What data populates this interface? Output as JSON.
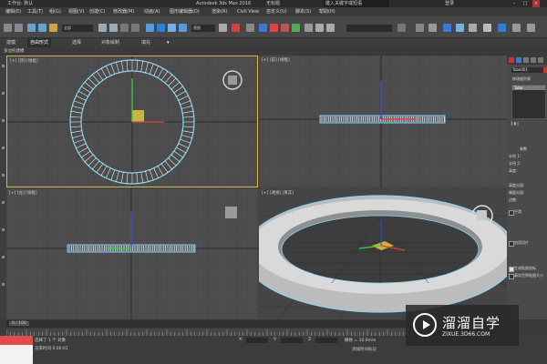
{
  "title_bar": {
    "left_label": "工作台: 默认",
    "app_title": "Autodesk 3ds Max 2016",
    "doc_title": "无标题",
    "search_placeholder": "键入关键字或短语",
    "login_label": "登录"
  },
  "menu": [
    "编辑(E)",
    "工具(T)",
    "组(G)",
    "视图(V)",
    "创建(C)",
    "修改器(M)",
    "动画(A)",
    "图形编辑器(D)",
    "渲染(R)",
    "Civil View",
    "自定义(U)",
    "脚本(S)",
    "帮助(H)"
  ],
  "toolbar": {
    "selection_filter": "全部",
    "view_dropdown": "视图"
  },
  "ribbon": {
    "tabs": [
      "建模",
      "自由形式",
      "选择",
      "对象绘制",
      "填充"
    ],
    "active_index": 1,
    "sub_label": "多边形建模"
  },
  "viewports": [
    {
      "label": "[+] [顶] [线框]",
      "name": "top"
    },
    {
      "label": "[+] [前] [线框]",
      "name": "front"
    },
    {
      "label": "[+] [左] [线框]",
      "name": "left"
    },
    {
      "label": "[+] [透视] [真实]",
      "name": "perspective"
    }
  ],
  "command_panel": {
    "object_name": "Tube001",
    "modifier_list_label": "修改器列表",
    "stack_items": [
      "Tube"
    ],
    "params_title": "参数",
    "params": [
      "半径 1:",
      "半径 2:",
      "高度:",
      "高度分段:",
      "端面分段:",
      "边数:"
    ],
    "checkbox_labels": [
      "平滑",
      "启用切片",
      "生成贴图坐标",
      "真实世界贴图大小"
    ],
    "accent_color": "#c83232"
  },
  "timeline": {
    "frame_label": "0 / 100"
  },
  "status": {
    "selected": "选择了 1 个 对象",
    "prompt": "渲染时间 0:00:01",
    "x_label": "X:",
    "y_label": "Y:",
    "z_label": "Z:",
    "grid_label": "栅格 = 10.0mm",
    "add_time_tag": "添加时间标记"
  },
  "watermark": {
    "title": "溜溜自学",
    "url": "ZIXUE.3D66.COM"
  },
  "colors": {
    "wireframe": "#87d3ee",
    "grid_dark": "#3e3e3e",
    "viewport_bg": "#4d4d4d",
    "active_border": "#d6b84a",
    "gizmo_x": "#e03a3a",
    "gizmo_y": "#3ad04a",
    "gizmo_z": "#3a4ae0"
  }
}
